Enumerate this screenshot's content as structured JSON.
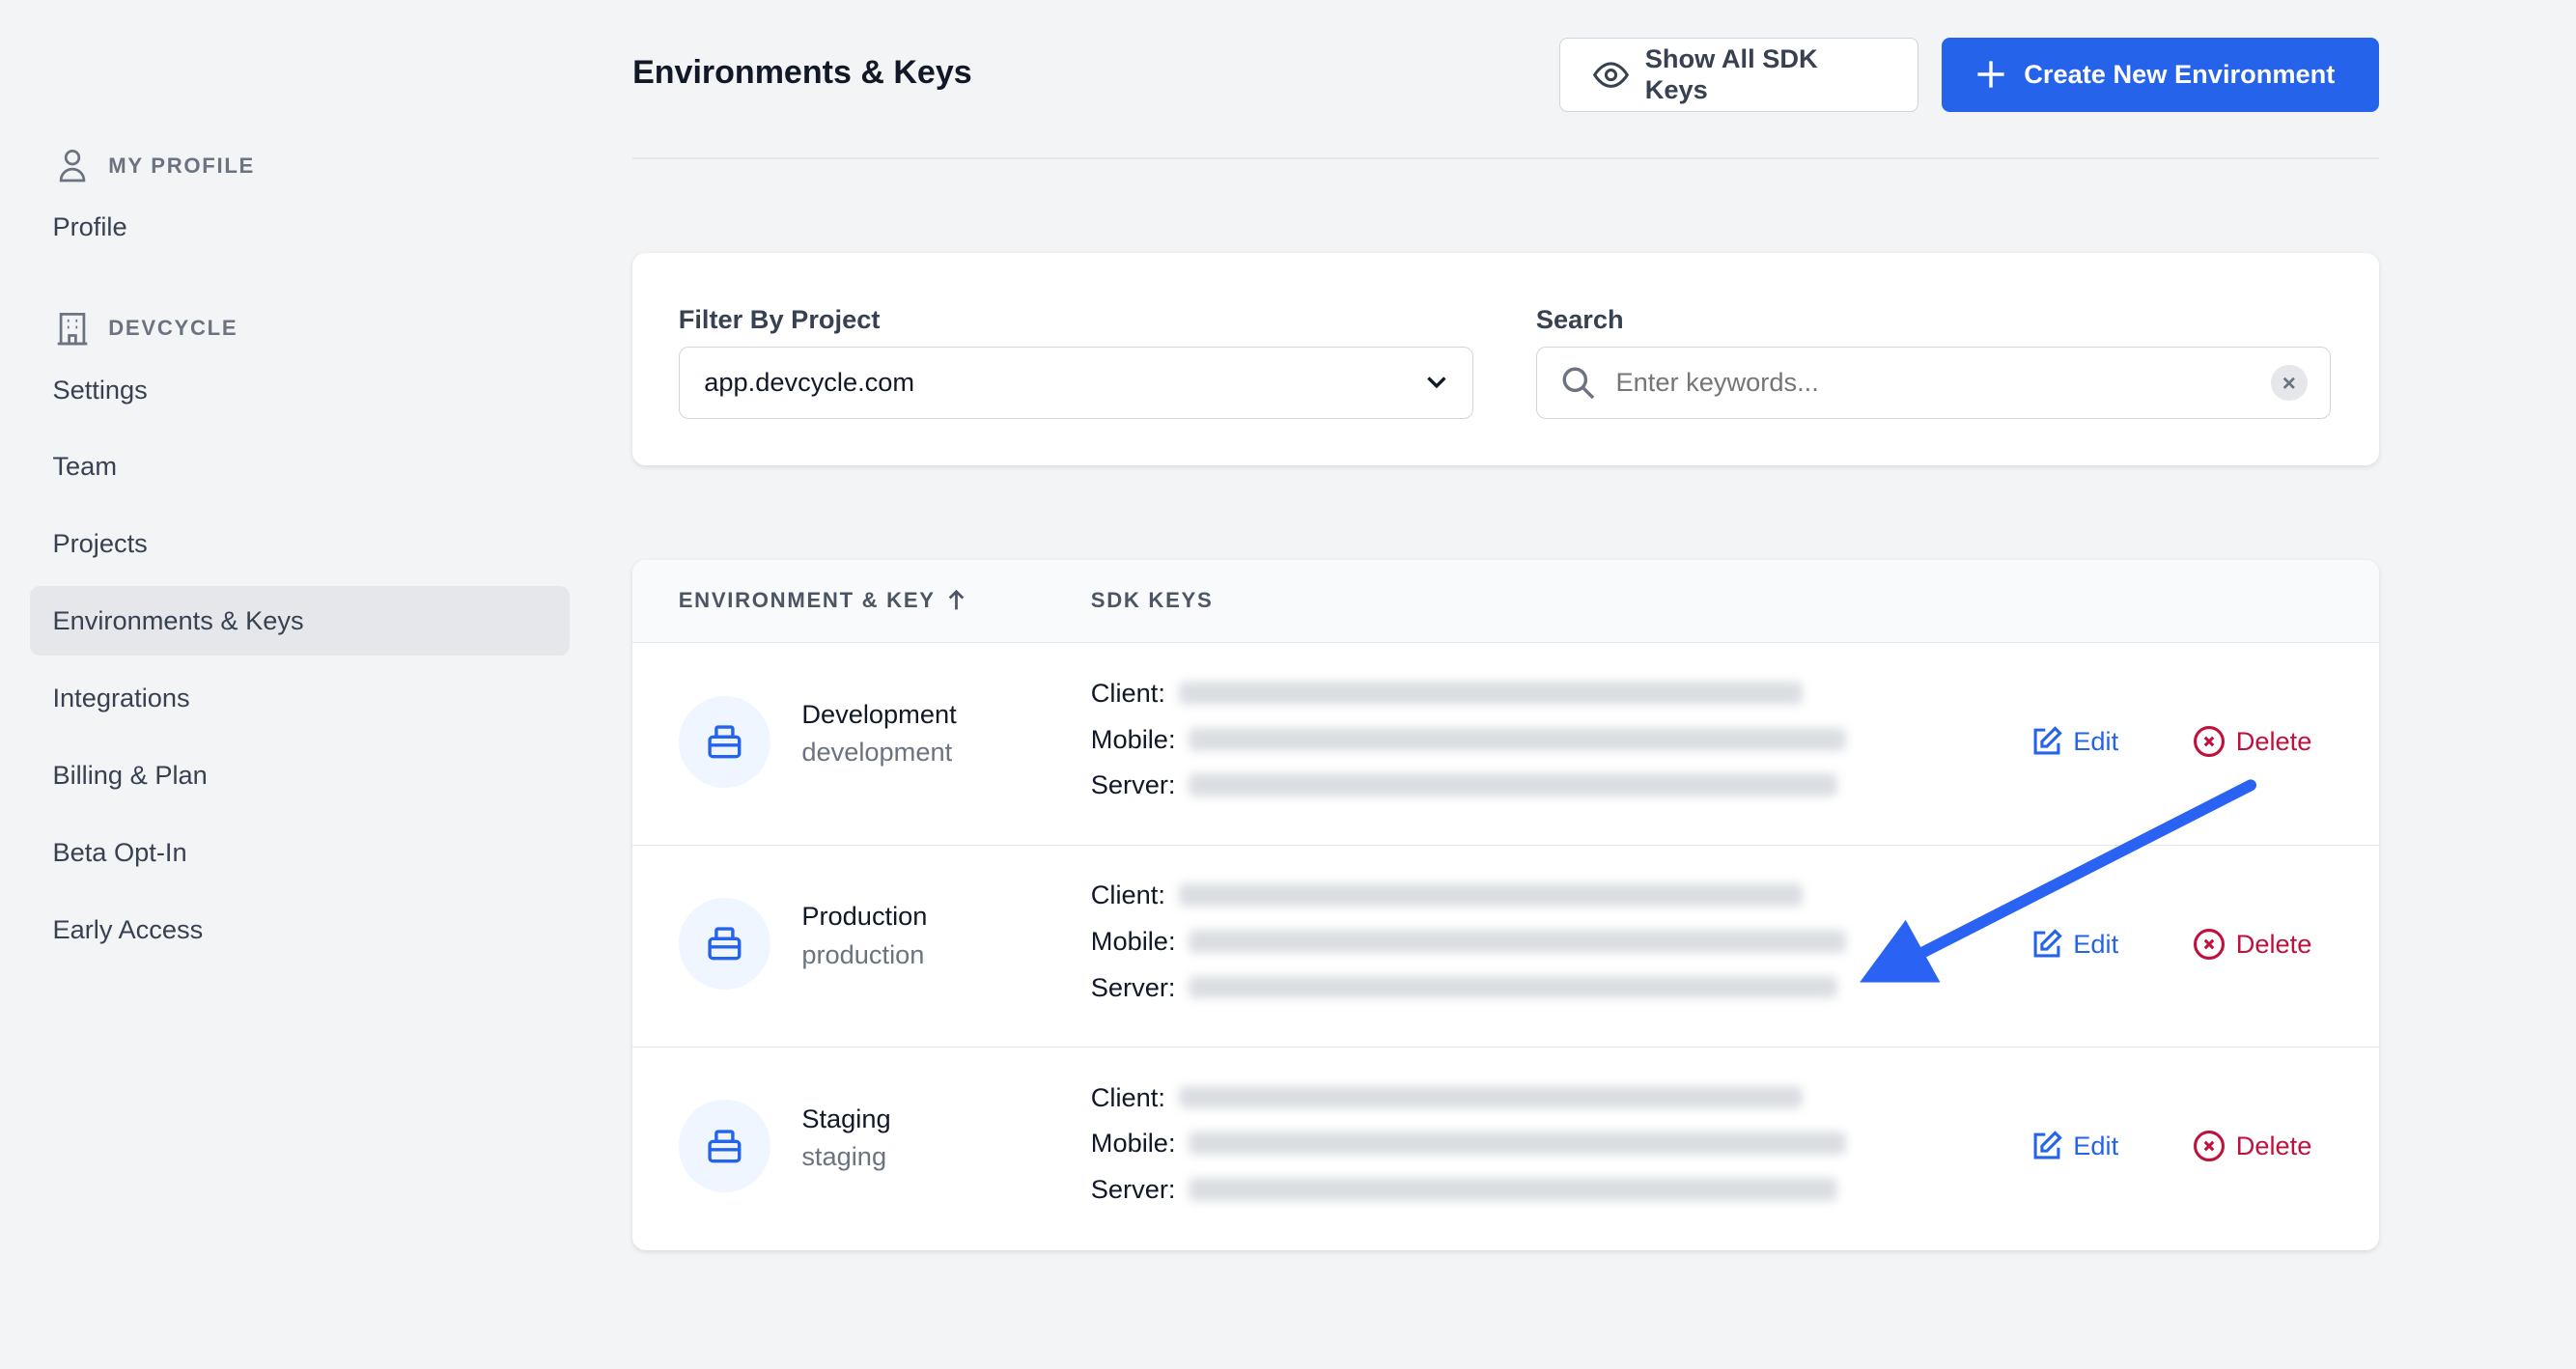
{
  "sidebar": {
    "sections": [
      {
        "icon": "user-icon",
        "label": "MY PROFILE",
        "items": [
          {
            "label": "Profile"
          }
        ]
      },
      {
        "icon": "building-icon",
        "label": "DEVCYCLE",
        "items": [
          {
            "label": "Settings"
          },
          {
            "label": "Team"
          },
          {
            "label": "Projects"
          },
          {
            "label": "Environments & Keys",
            "active": true
          },
          {
            "label": "Integrations"
          },
          {
            "label": "Billing & Plan"
          },
          {
            "label": "Beta Opt-In"
          },
          {
            "label": "Early Access"
          }
        ]
      }
    ]
  },
  "header": {
    "title": "Environments & Keys",
    "show_keys_label": "Show All SDK Keys",
    "create_label": "Create New Environment"
  },
  "filters": {
    "project_label": "Filter By Project",
    "project_value": "app.devcycle.com",
    "search_label": "Search",
    "search_placeholder": "Enter keywords..."
  },
  "table": {
    "headers": [
      "ENVIRONMENT & KEY",
      "SDK KEYS"
    ],
    "sort": "ascending",
    "key_labels": [
      "Client:",
      "Mobile:",
      "Server:"
    ],
    "edit_label": "Edit",
    "delete_label": "Delete",
    "rows": [
      {
        "name": "Development",
        "key": "development"
      },
      {
        "name": "Production",
        "key": "production"
      },
      {
        "name": "Staging",
        "key": "staging"
      }
    ]
  },
  "colors": {
    "accent": "#2563eb",
    "danger": "#be123c",
    "annotation_arrow": "#2a62f4"
  }
}
